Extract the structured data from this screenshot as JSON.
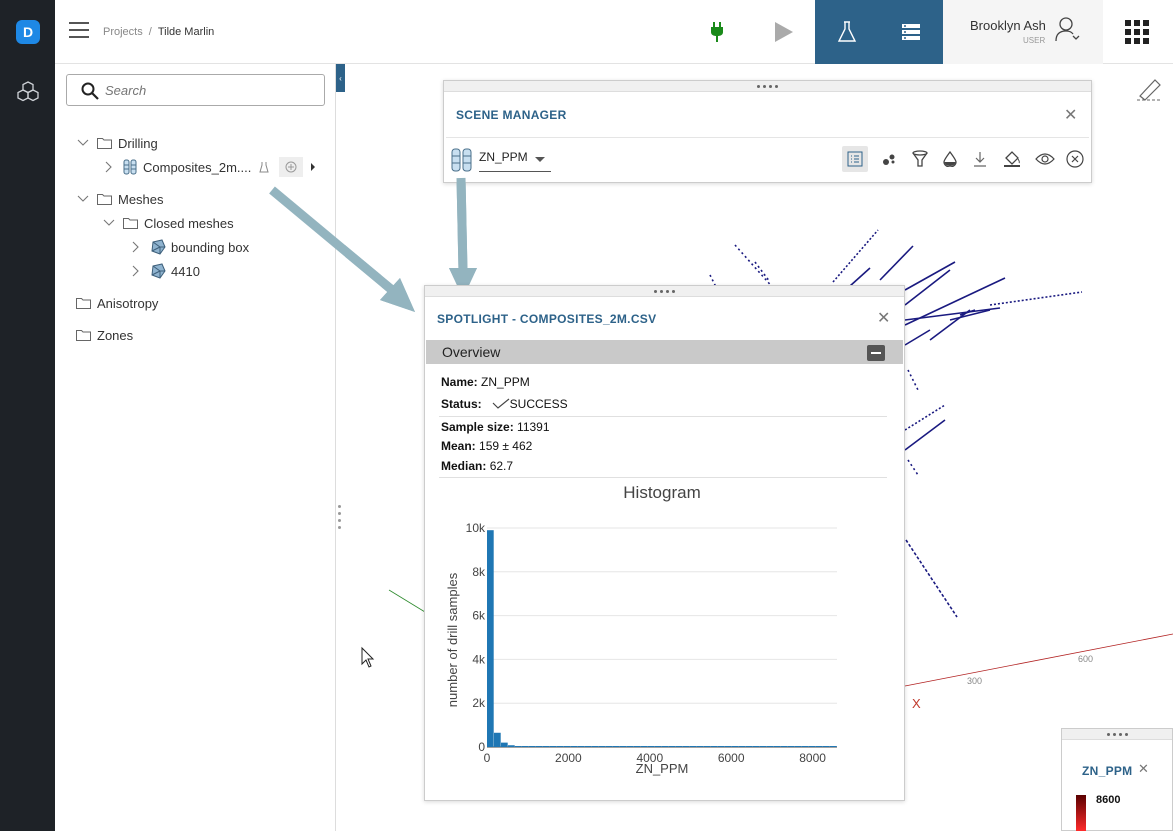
{
  "app": {
    "logo_letter": "D"
  },
  "header": {
    "breadcrumb_root": "Projects",
    "breadcrumb_sep": "/",
    "breadcrumb_current": "Tilde Marlin",
    "user_name": "Brooklyn Ash",
    "user_role": "USER",
    "colors": {
      "accent": "#2d6289",
      "plug": "#1a8a1a"
    }
  },
  "sidebar": {
    "search_placeholder": "Search",
    "tree": {
      "drilling": "Drilling",
      "composites": "Composites_2m....",
      "meshes": "Meshes",
      "closed_meshes": "Closed meshes",
      "bounding_box": "bounding box",
      "mesh_4410": "4410",
      "anisotropy": "Anisotropy",
      "zones": "Zones"
    }
  },
  "scene_manager": {
    "title": "SCENE MANAGER",
    "selected_attribute": "ZN_PPM",
    "tools": [
      "list-icon",
      "points-icon",
      "filter-icon",
      "drop-icon",
      "download-icon",
      "paint-bucket-icon",
      "eye-icon",
      "remove-icon"
    ]
  },
  "spotlight": {
    "title": "SPOTLIGHT - COMPOSITES_2M.CSV",
    "section": "Overview",
    "name_label": "Name:",
    "name_value": "ZN_PPM",
    "status_label": "Status:",
    "status_value": "SUCCESS",
    "sample_label": "Sample size:",
    "sample_value": "11391",
    "mean_label": "Mean:",
    "mean_value": "159 ± 462",
    "median_label": "Median:",
    "median_value": "62.7"
  },
  "chart_data": {
    "type": "bar",
    "title": "Histogram",
    "xlabel": "ZN_PPM",
    "ylabel": "number of drill samples",
    "xlim": [
      0,
      8600
    ],
    "ylim": [
      0,
      10000
    ],
    "x_ticks": [
      "0",
      "2000",
      "4000",
      "6000",
      "8000"
    ],
    "y_ticks": [
      "0",
      "2k",
      "4k",
      "6k",
      "8k",
      "10k"
    ],
    "bin_width": 172,
    "bins_start": [
      0,
      172,
      344,
      516,
      688,
      860
    ],
    "values": [
      9900,
      650,
      200,
      80,
      40,
      20
    ],
    "tail_value": 10,
    "color": "#1f77b4",
    "grid": true
  },
  "viewport": {
    "axis_label_1": "300",
    "axis_label_2": "600",
    "axis_x_label": "X"
  },
  "legend": {
    "title": "ZN_PPM",
    "max_value": "8600"
  }
}
